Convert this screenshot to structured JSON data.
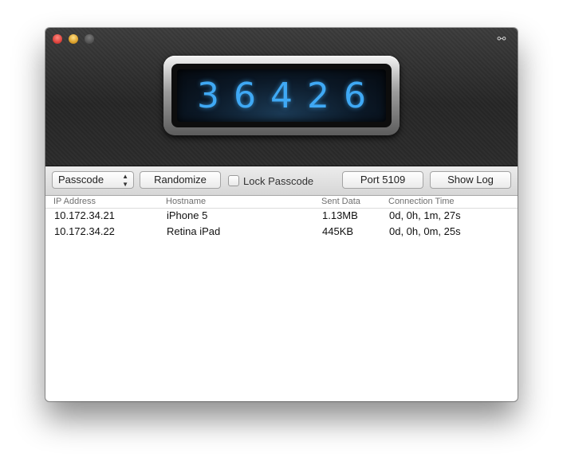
{
  "window": {
    "fullscreen_icon": "fullscreen-arrows-icon"
  },
  "display": {
    "passcode": "36426"
  },
  "toolbar": {
    "mode_select": "Passcode",
    "randomize_label": "Randomize",
    "lock_label": "Lock Passcode",
    "lock_checked": false,
    "port_label": "Port 5109",
    "show_log_label": "Show Log"
  },
  "table": {
    "headers": [
      "IP Address",
      "Hostname",
      "Sent Data",
      "Connection Time"
    ],
    "rows": [
      {
        "ip": "10.172.34.21",
        "host": "iPhone 5",
        "sent": "1.13MB",
        "time": "0d, 0h, 1m, 27s"
      },
      {
        "ip": "10.172.34.22",
        "host": "Retina iPad",
        "sent": "445KB",
        "time": "0d, 0h, 0m, 25s"
      }
    ]
  },
  "colors": {
    "digit_glow": "#3fa9f5",
    "titlebar": "#2b2b2b"
  }
}
